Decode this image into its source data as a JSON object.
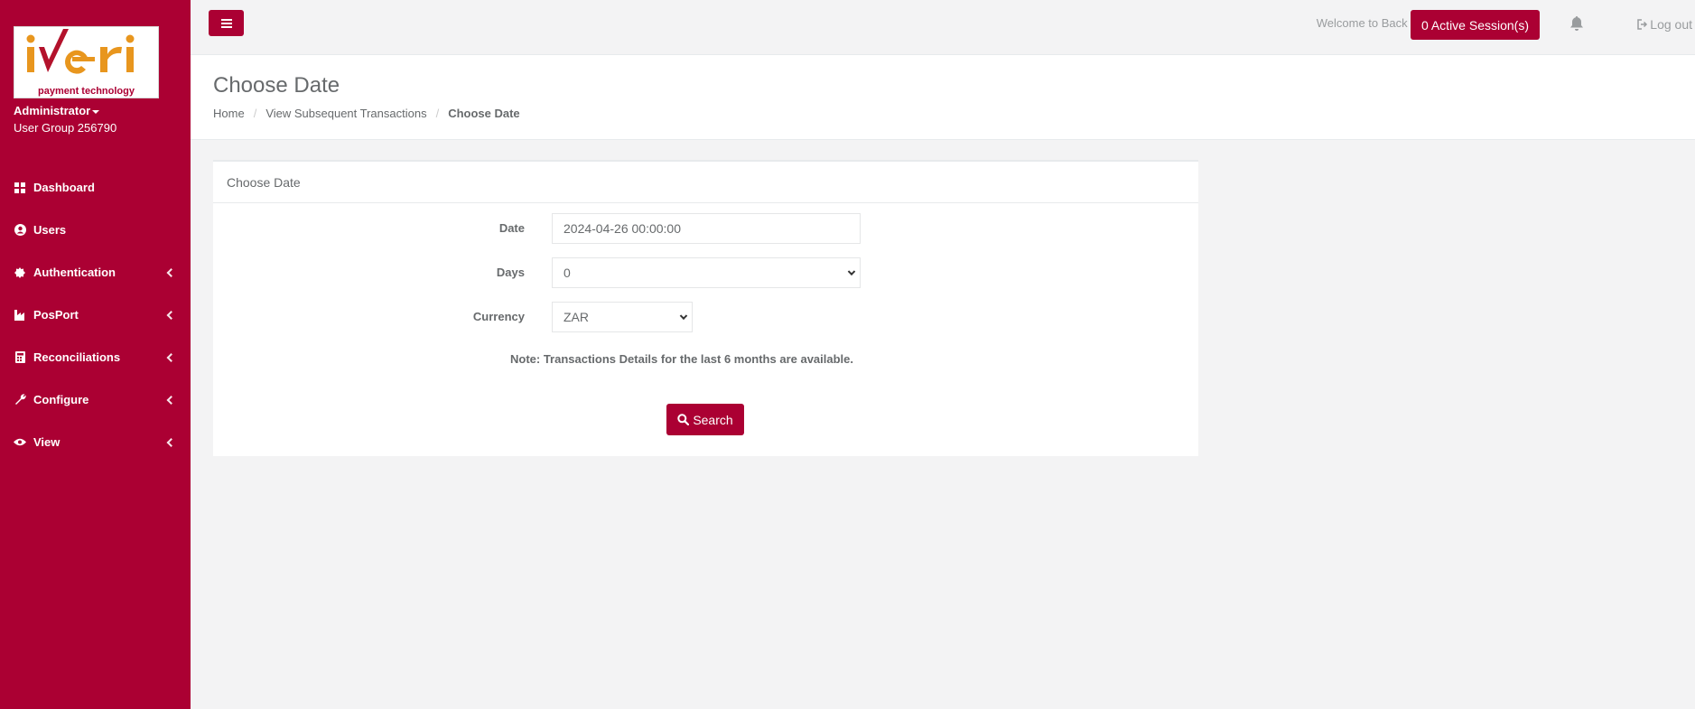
{
  "brand": {
    "logo_text": "iveri",
    "tagline": "payment technology",
    "colors": {
      "primary": "#ab0033",
      "logo_orange": "#e8961e",
      "logo_red": "#b3122c"
    }
  },
  "profile": {
    "name": "Administrator",
    "group": "User Group 256790"
  },
  "sidebar": {
    "items": [
      {
        "label": "Dashboard",
        "icon": "dashboard-icon",
        "has_submenu": false
      },
      {
        "label": "Users",
        "icon": "user-circle-icon",
        "has_submenu": false
      },
      {
        "label": "Authentication",
        "icon": "certificate-icon",
        "has_submenu": true
      },
      {
        "label": "PosPort",
        "icon": "industry-icon",
        "has_submenu": true
      },
      {
        "label": "Reconciliations",
        "icon": "calculator-icon",
        "has_submenu": true
      },
      {
        "label": "Configure",
        "icon": "wrench-icon",
        "has_submenu": true
      },
      {
        "label": "View",
        "icon": "eye-icon",
        "has_submenu": true
      }
    ]
  },
  "topbar": {
    "welcome": "Welcome to Back Office",
    "sessions_label": "0 Active Session(s)",
    "logout_label": "Log out"
  },
  "heading": {
    "title": "Choose Date",
    "breadcrumb": [
      "Home",
      "View Subsequent Transactions",
      "Choose Date"
    ]
  },
  "panel": {
    "title": "Choose Date",
    "date_label": "Date",
    "date_value": "2024-04-26 00:00:00",
    "days_label": "Days",
    "days_value": "0",
    "currency_label": "Currency",
    "currency_value": "ZAR",
    "note": "Note: Transactions Details for the last 6 months are available.",
    "search_label": "Search"
  }
}
